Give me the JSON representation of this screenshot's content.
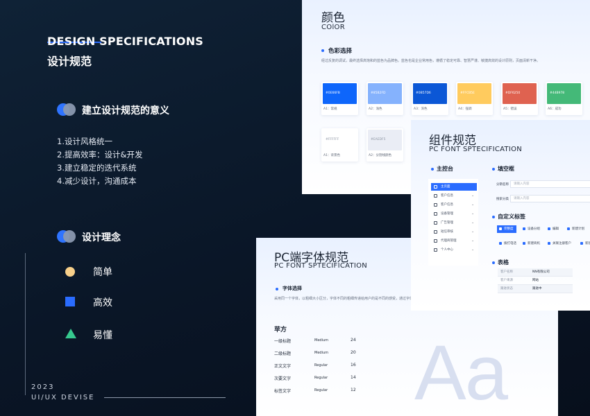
{
  "colors": {
    "accent": "#2A6CFF",
    "dark_bg": "#0A1627",
    "concept_yellow": "#F8D08A",
    "concept_green": "#36C98E"
  },
  "left": {
    "header_en": "DESIGN SPECIFICATIONS",
    "header_cn": "设计规范",
    "section1_title": "建立设计规范的意义",
    "reasons": [
      "1.设计风格统一",
      "2.提高效率：设计&开发",
      "3.建立稳定的迭代系统",
      "4.减少设计，沟通成本"
    ],
    "section2_title": "设计理念",
    "concepts": [
      {
        "label": "简单",
        "icon": "yellow-circle-icon"
      },
      {
        "label": "高效",
        "icon": "blue-square-icon"
      },
      {
        "label": "易懂",
        "icon": "green-triangle-icon"
      }
    ],
    "year": "2023",
    "footer": "UI/UX DEVISE"
  },
  "color_card": {
    "title": "颜色",
    "subtitle": "COlOR",
    "section": "色彩选择",
    "desc": "经过反复的调试，最终选择高饱和的蓝色为品牌色。蓝色也是企业常用色，遵循了稳定可靠、智慧严谨、敏捷高效的设计原则，页面清新干净。",
    "swatches": [
      {
        "hex": "#0E66FB",
        "label": "A1：常规",
        "color": "#0E66FB"
      },
      {
        "hex": "#85B2FD",
        "label": "A2：浅色",
        "color": "#85B2FD"
      },
      {
        "hex": "#0B57D6",
        "label": "A3：深色",
        "color": "#0B57D6"
      },
      {
        "hex": "#FFCB5E",
        "label": "A4：强调",
        "color": "#FFCB5E"
      },
      {
        "hex": "#DF6250",
        "label": "A5：错误",
        "color": "#DF6250"
      },
      {
        "hex": "#44B978",
        "label": "A6：成功",
        "color": "#44B978"
      },
      {
        "hex": "#FFFFFF",
        "label": "A1：背景色",
        "color": "#FFFFFF"
      },
      {
        "hex": "#EAEDF5",
        "label": "A2：分割线颜色",
        "color": "#EAEDF5"
      }
    ]
  },
  "comp_card": {
    "title": "组件规范",
    "subtitle": "PC FONT SPTECIFICATION",
    "sec_console": "主控台",
    "sec_fill": "填空框",
    "sec_tags": "自定义标签",
    "sec_table": "表格",
    "menu": [
      {
        "label": "主页面",
        "chev": ""
      },
      {
        "label": "客户信息",
        "chev": "⌄"
      },
      {
        "label": "客户信息",
        "chev": "⌄"
      },
      {
        "label": "设备管理",
        "chev": "⌄"
      },
      {
        "label": "广告管理",
        "chev": "⌄"
      },
      {
        "label": "短信审核",
        "chev": "⌄"
      },
      {
        "label": "代理商管理",
        "chev": "⌄"
      },
      {
        "label": "个人中心",
        "chev": "⌄"
      }
    ],
    "fields": [
      {
        "label": "分销名称",
        "placeholder": "请输入内容"
      },
      {
        "label": "搜索分类",
        "placeholder": "请输入内容"
      }
    ],
    "tags_row1": [
      "完整度",
      "设备分组",
      "编辑",
      "新建计划"
    ],
    "tags_row2": [
      "拨打电话",
      "新建商机",
      "关联注册客户",
      "新建"
    ],
    "table": [
      [
        "客户名称",
        "NN有限公司"
      ],
      [
        "客户来源",
        "网站"
      ],
      [
        "跟进状态",
        "跟进中"
      ]
    ]
  },
  "font_card": {
    "title": "PC端字体规范",
    "subtitle": "PC FONT SPTECIFICATION",
    "section": "字体选择",
    "desc": "采用同一个字体，以粗细大小区分，字体不同的粗细传递给用户的是不同的感受，通过字体排版",
    "font_name": "苹方",
    "rows": [
      {
        "name": "一级标题",
        "weight": "Medium",
        "size": "24"
      },
      {
        "name": "二级标题",
        "weight": "Medium",
        "size": "20"
      },
      {
        "name": "正文文字",
        "weight": "Regular",
        "size": "16"
      },
      {
        "name": "次要文字",
        "weight": "Regular",
        "size": "14"
      },
      {
        "name": "标签文字",
        "weight": "Regular",
        "size": "12"
      }
    ],
    "big_glyph": "Aa"
  }
}
